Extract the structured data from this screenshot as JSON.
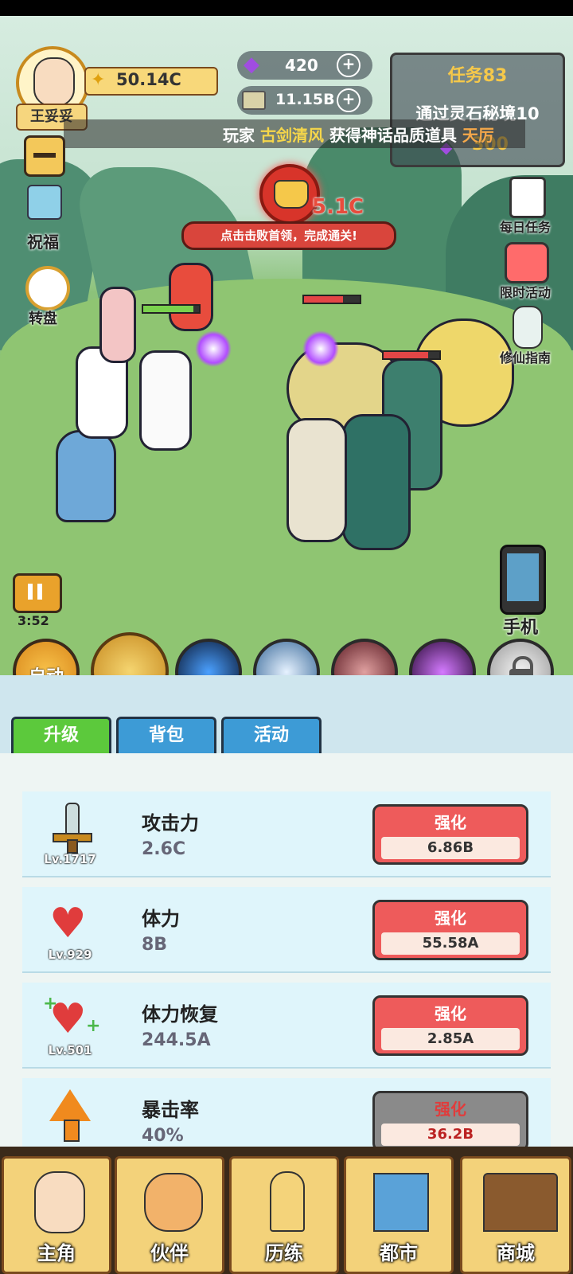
{
  "player": {
    "name": "王妥妥",
    "gold": "50.14C"
  },
  "currency": {
    "gems": "420",
    "cash": "11.15B",
    "plus": "+"
  },
  "quest": {
    "title": "任务83",
    "desc": "通过灵石秘境10",
    "reward": "300"
  },
  "broadcast": {
    "prefix": "玩家",
    "player": "古剑清风",
    "middle": "获得神话品质道具",
    "item": "天厉"
  },
  "boss": {
    "hp_text": "5.1C",
    "hint": "点击击败首领，完成通关!"
  },
  "left_menu": {
    "blessing": "祝福",
    "wheel": "转盘"
  },
  "right_menu": {
    "daily": "每日任务",
    "limited": "限时活动",
    "guide": "修仙指南",
    "phone": "手机"
  },
  "battle": {
    "timer": "3:52"
  },
  "skills": {
    "auto": "自动"
  },
  "tabs": {
    "upgrade": "升级",
    "bag": "背包",
    "activity": "活动"
  },
  "upgrades": [
    {
      "name": "攻击力",
      "value": "2.6C",
      "level": "Lv.1717",
      "button": "强化",
      "cost": "6.86B",
      "icon": "sword-icon"
    },
    {
      "name": "体力",
      "value": "8B",
      "level": "Lv.929",
      "button": "强化",
      "cost": "55.58A",
      "icon": "heart-icon"
    },
    {
      "name": "体力恢复",
      "value": "244.5A",
      "level": "Lv.501",
      "button": "强化",
      "cost": "2.85A",
      "icon": "heart-plus-icon"
    },
    {
      "name": "暴击率",
      "value": "40%",
      "level": "",
      "button": "强化",
      "cost": "36.2B",
      "icon": "crit-arrow-icon"
    }
  ],
  "nav": {
    "hero": "主角",
    "partner": "伙伴",
    "training": "历练",
    "city": "都市",
    "shop": "商城"
  },
  "colors": {
    "upgrade_red": "#ee5b5b",
    "upgrade_disabled": "#8a8a8a",
    "tab_active": "#5cc93c",
    "tab_inactive": "#3d9bd6",
    "gold_bar": "#f8d87a"
  }
}
